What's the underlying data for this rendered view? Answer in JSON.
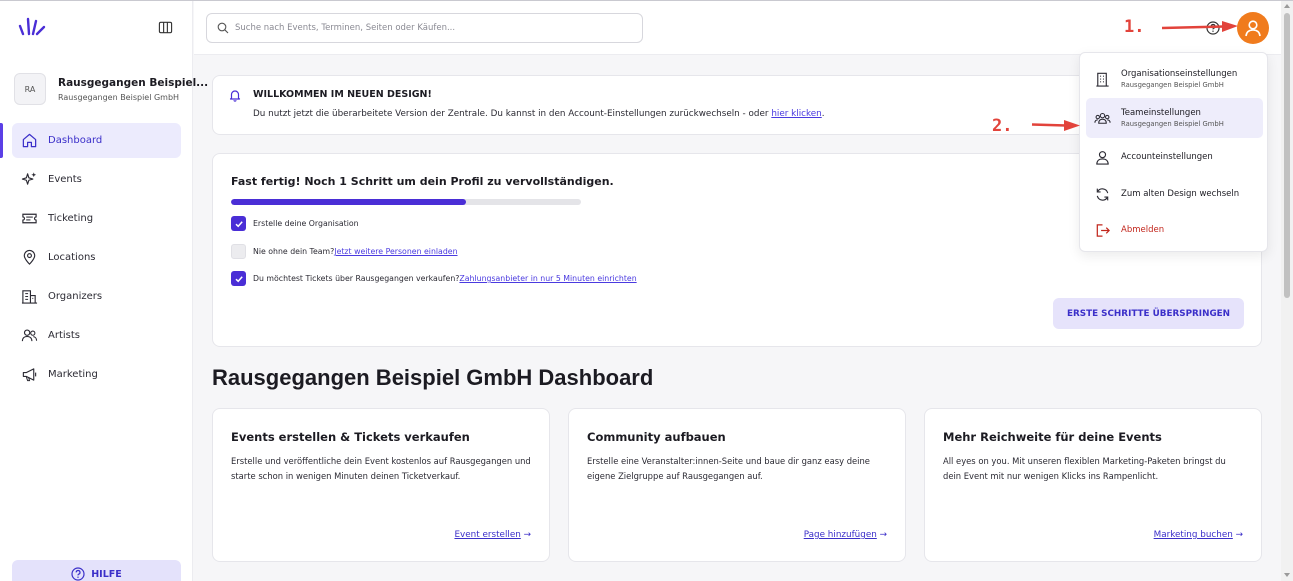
{
  "sidebar": {
    "org": {
      "initials": "RA",
      "name": "Rausgegangen Beispiel...",
      "sub": "Rausgegangen Beispiel GmbH"
    },
    "items": [
      {
        "label": "Dashboard",
        "icon": "home-icon",
        "active": true
      },
      {
        "label": "Events",
        "icon": "sparkle-icon"
      },
      {
        "label": "Ticketing",
        "icon": "ticket-icon"
      },
      {
        "label": "Locations",
        "icon": "location-pin-icon"
      },
      {
        "label": "Organizers",
        "icon": "building-icon"
      },
      {
        "label": "Artists",
        "icon": "users-icon"
      },
      {
        "label": "Marketing",
        "icon": "megaphone-icon"
      }
    ],
    "help_label": "HILFE"
  },
  "header": {
    "search_placeholder": "Suche nach Events, Terminen, Seiten oder Käufen..."
  },
  "welcome": {
    "title": "WILLKOMMEN IM NEUEN DESIGN!",
    "text": "Du nutzt jetzt die überarbeitete Version der Zentrale. Du kannst in den Account-Einstellungen zurückwechseln - oder ",
    "link": "hier klicken",
    "suffix": "."
  },
  "onboarding": {
    "title": "Fast fertig! Noch 1 Schritt um dein Profil zu vervollständigen.",
    "progress": 0.67,
    "steps": [
      {
        "checked": true,
        "text": "Erstelle deine Organisation",
        "link": ""
      },
      {
        "checked": false,
        "text": "Nie ohne dein Team? ",
        "link": "Jetzt weitere Personen einladen"
      },
      {
        "checked": true,
        "text": "Du möchtest Tickets über Rausgegangen verkaufen? ",
        "link": "Zahlungsanbieter in nur 5 Minuten einrichten"
      }
    ],
    "skip_label": "ERSTE SCHRITTE ÜBERSPRINGEN"
  },
  "dashboard_title": "Rausgegangen Beispiel GmbH Dashboard",
  "features": [
    {
      "title": "Events erstellen & Tickets verkaufen",
      "text": "Erstelle und veröffentliche dein Event kostenlos auf Rausgegangen und starte schon in wenigen Minuten deinen Ticketverkauf.",
      "link": "Event erstellen"
    },
    {
      "title": "Community aufbauen",
      "text": "Erstelle eine Veranstalter:innen-Seite und baue dir ganz easy deine eigene Zielgruppe auf Rausgegangen auf.",
      "link": "Page hinzufügen"
    },
    {
      "title": "Mehr Reichweite für deine Events",
      "text": "All eyes on you. Mit unseren flexiblen Marketing-Paketen bringst du dein Event mit nur wenigen Klicks ins Rampenlicht.",
      "link": "Marketing buchen"
    }
  ],
  "dropdown": {
    "items": [
      {
        "label": "Organisationseinstellungen",
        "sub": "Rausgegangen Beispiel GmbH",
        "icon": "building-icon"
      },
      {
        "label": "Teameinstellungen",
        "sub": "Rausgegangen Beispiel GmbH",
        "icon": "team-icon",
        "highlighted": true
      },
      {
        "label": "Accounteinstellungen",
        "sub": "",
        "icon": "user-icon"
      },
      {
        "label": "Zum alten Design wechseln",
        "sub": "",
        "icon": "refresh-icon"
      },
      {
        "label": "Abmelden",
        "sub": "",
        "icon": "logout-icon"
      }
    ]
  },
  "annotations": {
    "step1": "1.",
    "step2": "2."
  },
  "colors": {
    "accent": "#4a2ed6",
    "avatar": "#f07b1d",
    "annotation": "#e2433b",
    "danger": "#c2261c"
  }
}
